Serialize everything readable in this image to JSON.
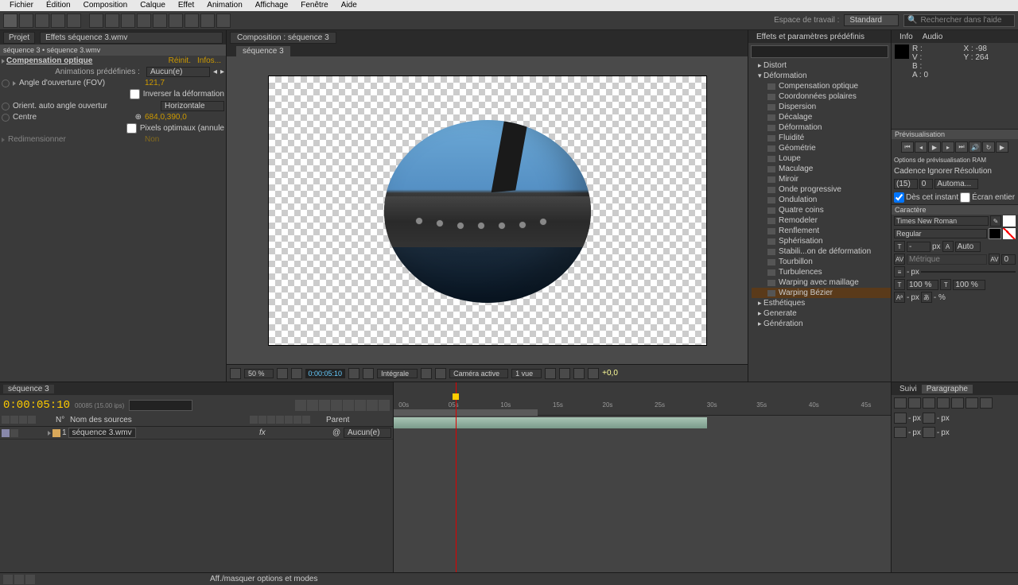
{
  "menu": {
    "items": [
      "Fichier",
      "Édition",
      "Composition",
      "Calque",
      "Effet",
      "Animation",
      "Affichage",
      "Fenêtre",
      "Aide"
    ]
  },
  "workspace": {
    "label": "Espace de travail :",
    "value": "Standard"
  },
  "searchHelp": {
    "placeholder": "Rechercher dans l'aide"
  },
  "projectTab": "Projet",
  "effectsSeqTab": "Effets séquence 3.wmv",
  "breadcrumb": "séquence 3 • séquence 3.wmv",
  "effect": {
    "name": "Compensation optique",
    "reset": "Réinit.",
    "info": "Infos...",
    "presetsLabel": "Animations prédéfinies :",
    "presetsValue": "Aucun(e)",
    "fovLabel": "Angle d'ouverture (FOV)",
    "fovValue": "121,7",
    "reverseLabel": "Inverser la déformation",
    "orientLabel": "Orient. auto angle ouvertur",
    "orientValue": "Horizontale",
    "centerLabel": "Centre",
    "centerValue": "684,0,390,0",
    "optLabel": "Pixels optimaux (annule",
    "resizeLabel": "Redimensionner",
    "resizeValue": "Non"
  },
  "compTab": "Composition : séquence 3",
  "compSubTab": "séquence 3",
  "viewer": {
    "zoom": "50 %",
    "time": "0:00:05:10",
    "res": "Intégrale",
    "view": "Caméra active",
    "views": "1 vue",
    "exp": "+0,0"
  },
  "effectsPanel": {
    "tab": "Effets et paramètres prédéfinis",
    "cats": [
      "Distort",
      "Déformation"
    ],
    "items": [
      "Compensation optique",
      "Coordonnées polaires",
      "Dispersion",
      "Décalage",
      "Déformation",
      "Fluidité",
      "Géométrie",
      "Loupe",
      "Maculage",
      "Miroir",
      "Onde progressive",
      "Ondulation",
      "Quatre coins",
      "Remodeler",
      "Renflement",
      "Sphérisation",
      "Stabili...on de déformation",
      "Tourbillon",
      "Turbulences",
      "Warping avec maillage",
      "Warping Bézier"
    ],
    "cats2": [
      "Esthétiques",
      "Generate",
      "Génération"
    ]
  },
  "info": {
    "tab1": "Info",
    "tab2": "Audio",
    "r": "R :",
    "v": "V :",
    "b": "B :",
    "a": "A : 0",
    "x": "X : -98",
    "y": "Y : 264"
  },
  "preview": {
    "tab": "Prévisualisation",
    "ramLabel": "Options de prévisualisation RAM",
    "cadence": "Cadence",
    "ignorer": "Ignorer",
    "resolution": "Résolution",
    "cadenceVal": "(15)",
    "ignorerVal": "0",
    "resVal": "Automa...",
    "fromNow": "Dès cet instant",
    "fullScreen": "Écran entier"
  },
  "character": {
    "tab": "Caractère",
    "font": "Times New Roman",
    "style": "Regular",
    "sizeUnit": "px",
    "auto": "Auto",
    "pct": "100 %"
  },
  "paragraph": {
    "tab1": "Suivi",
    "tab2": "Paragraphe",
    "px": "px"
  },
  "timeline": {
    "tab": "séquence 3",
    "time": "0:00:05:10",
    "frames": "00085 (15.00 ips)",
    "colNum": "N°",
    "colName": "Nom des sources",
    "colParent": "Parent",
    "layerNum": "1",
    "layerName": "séquence 3.wmv",
    "layerParent": "Aucun(e)",
    "ticks": [
      "00s",
      "05s",
      "10s",
      "15s",
      "20s",
      "25s",
      "30s",
      "35s",
      "40s",
      "45s"
    ]
  },
  "status": "Aff./masquer options et modes"
}
